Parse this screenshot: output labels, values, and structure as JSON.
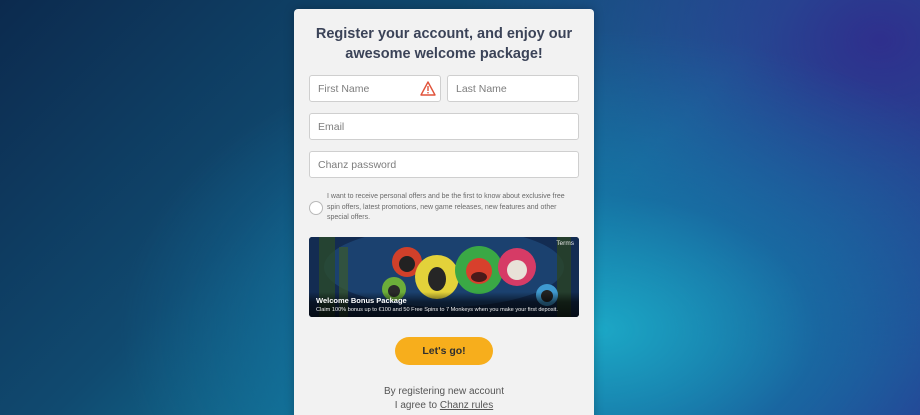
{
  "form": {
    "heading": "Register your account, and enjoy our awesome welcome package!",
    "fields": {
      "first_name_placeholder": "First Name",
      "last_name_placeholder": "Last Name",
      "email_placeholder": "Email",
      "password_placeholder": "Chanz password"
    },
    "first_name_status_icon": "warning-icon",
    "consent_text": "I want to receive personal offers and be the first to know about exclusive free spin offers, latest promotions, new game releases, new features and other special offers.",
    "submit_label": "Let's go!",
    "terms_line1": "By registering new account",
    "terms_prefix": "I agree to",
    "terms_link": "Chanz rules"
  },
  "promo": {
    "tag": "Terms",
    "title": "Welcome Bonus Package",
    "description": "Claim 100% bonus up to €100 and 50 Free Spins to 7 Monkeys when you make your first deposit."
  },
  "colors": {
    "accent": "#f7ae1c",
    "card": "#f2f2f2",
    "warning": "#e0523a",
    "heading": "#3b4358"
  }
}
